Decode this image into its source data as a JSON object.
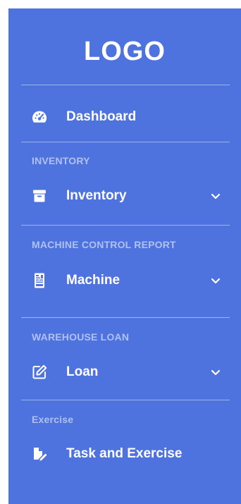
{
  "sidebar": {
    "logo": "LOGO",
    "dashboard": {
      "label": "Dashboard",
      "icon": "tachometer-icon"
    },
    "sections": [
      {
        "heading": "INVENTORY",
        "item": {
          "label": "Inventory",
          "icon": "archive-box-icon",
          "expandable": true
        }
      },
      {
        "heading": "MACHINE CONTROL REPORT",
        "item": {
          "label": "Machine",
          "icon": "machine-icon",
          "expandable": true
        }
      },
      {
        "heading": "WAREHOUSE LOAN",
        "item": {
          "label": "Loan",
          "icon": "edit-icon",
          "expandable": true
        }
      },
      {
        "heading": "Exercise",
        "item": {
          "label": "Task and Exercise",
          "icon": "task-icon",
          "expandable": false
        }
      }
    ]
  },
  "colors": {
    "sidebar_background": "#4e73df",
    "text": "#ffffff",
    "heading_text": "rgba(255,255,255,0.55)"
  }
}
